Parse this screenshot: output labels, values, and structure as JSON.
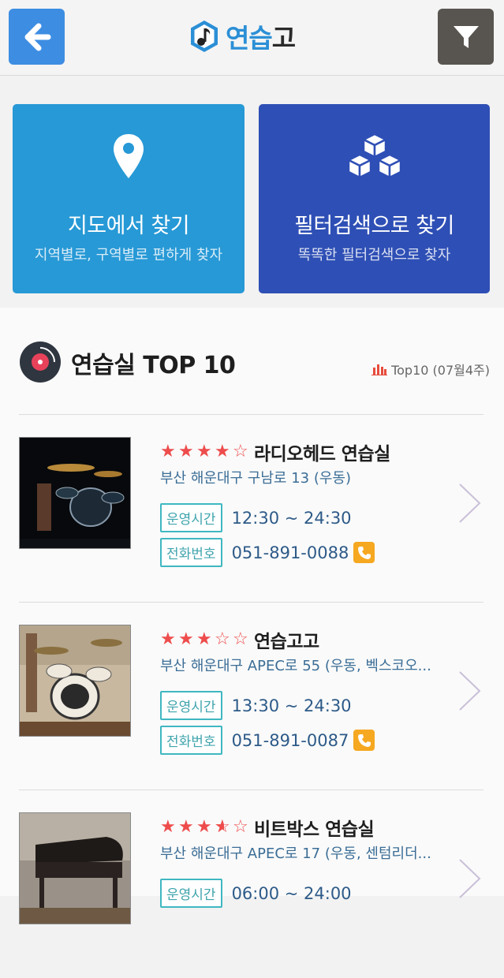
{
  "header": {
    "logo_part1": "연습",
    "logo_part2": "고",
    "back_icon": "arrow-left-icon",
    "filter_icon": "filter-icon",
    "back_color": "#3d8de2",
    "filter_color": "#585450"
  },
  "tiles": {
    "map": {
      "title": "지도에서 찾기",
      "subtitle": "지역별로, 구역별로 편하게 찾자",
      "icon": "map-pin-icon",
      "color": "#2799d6"
    },
    "filter": {
      "title": "필터검색으로 찾기",
      "subtitle": "똑똑한 필터검색으로 찾자",
      "icon": "boxes-icon",
      "color": "#2e4fb5"
    }
  },
  "section": {
    "title": "연습실 TOP 10",
    "rank_label": "Top10 (07월4주)"
  },
  "labels": {
    "hours": "운영시간",
    "phone": "전화번호"
  },
  "items": [
    {
      "rating": 4,
      "name": "라디오헤드 연습실",
      "address": "부산 해운대구 구남로 13 (우동)",
      "hours": "12:30 ~ 24:30",
      "phone": "051-891-0088"
    },
    {
      "rating": 3,
      "name": "연습고고",
      "address": "부산 해운대구 APEC로 55 (우동, 벡스코오...",
      "hours": "13:30 ~ 24:30",
      "phone": "051-891-0087"
    },
    {
      "rating": 3.5,
      "name": "비트박스 연습실",
      "address": "부산 해운대구 APEC로 17 (우동, 센텀리더...",
      "hours": "06:00 ~ 24:00",
      "phone": ""
    }
  ],
  "colors": {
    "accent_star": "#ee4c4c",
    "tag_border": "#3fb7c1",
    "phone_badge": "#f6a821"
  }
}
